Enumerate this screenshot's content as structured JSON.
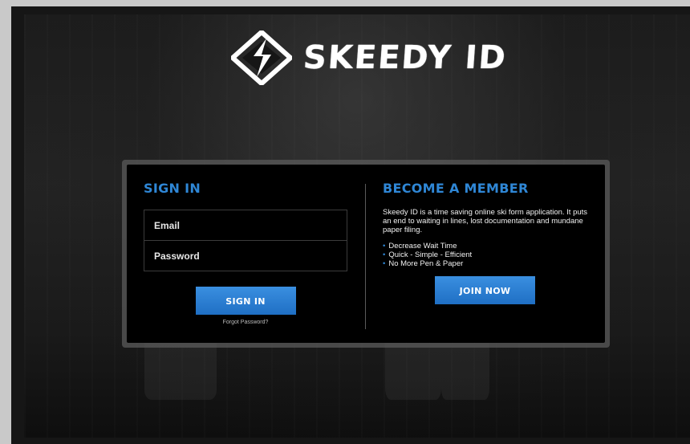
{
  "brand": {
    "name": "SKEEDY ID",
    "accent_color": "#2f87d6"
  },
  "signin": {
    "heading": "SIGN IN",
    "email_placeholder": "Email",
    "password_placeholder": "Password",
    "button_label": "SIGN IN",
    "forgot_label": "Forgot Password?"
  },
  "member": {
    "heading": "BECOME A MEMBER",
    "description": "Skeedy ID is a time saving online ski form application. It puts an end to waiting in lines, lost documentation and mundane paper filing.",
    "bullets": [
      "Decrease Wait Time",
      "Quick - Simple - Efficient",
      "No More Pen & Paper"
    ],
    "button_label": "JOIN NOW"
  }
}
